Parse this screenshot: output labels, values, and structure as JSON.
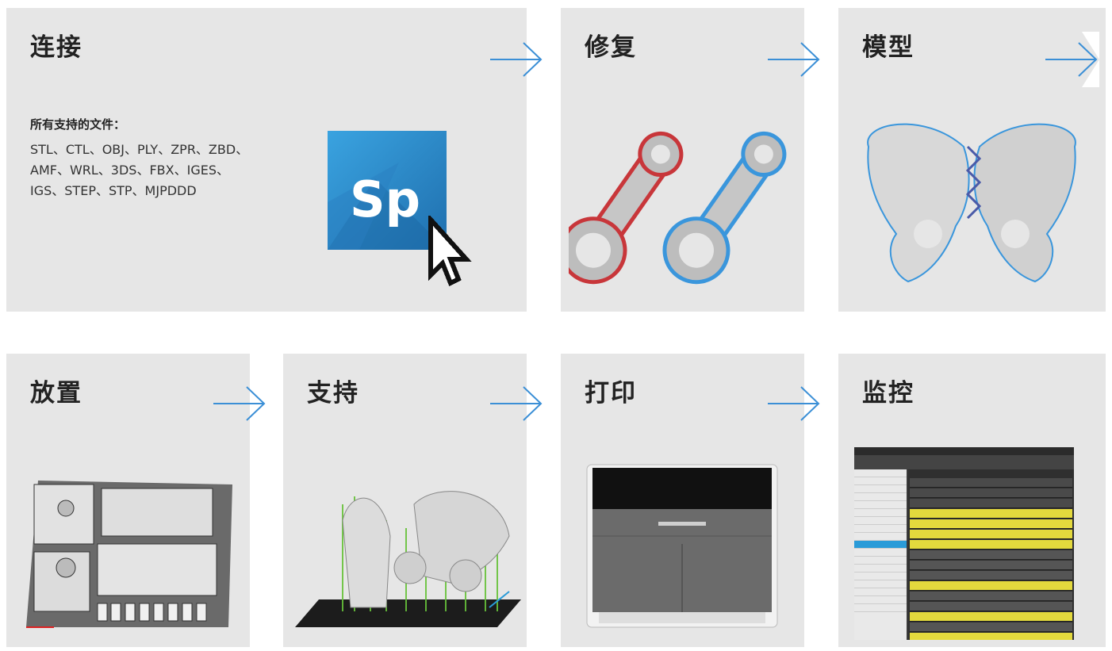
{
  "steps": [
    {
      "title": "连接"
    },
    {
      "title": "修复"
    },
    {
      "title": "模型"
    },
    {
      "title": "放置"
    },
    {
      "title": "支持"
    },
    {
      "title": "打印"
    },
    {
      "title": "监控"
    }
  ],
  "connect": {
    "formats_heading": "所有支持的文件：",
    "formats_line1": "STL、CTL、OBJ、PLY、ZPR、ZBD、",
    "formats_line2": "AMF、WRL、3DS、FBX、IGES、",
    "formats_line3": "IGS、STEP、STP、MJPDDD",
    "logo_text": "Sp"
  },
  "colors": {
    "card_bg": "#e6e6e6",
    "arrow": "#3b8fd6",
    "logo_blue": "#2a8fd0",
    "repair_red": "#c8363a",
    "repair_blue": "#3a96dc",
    "support_green": "#67c23a",
    "queue_yellow": "#e3d93d"
  },
  "icons": [
    "arrow-right-icon",
    "cursor-icon"
  ]
}
